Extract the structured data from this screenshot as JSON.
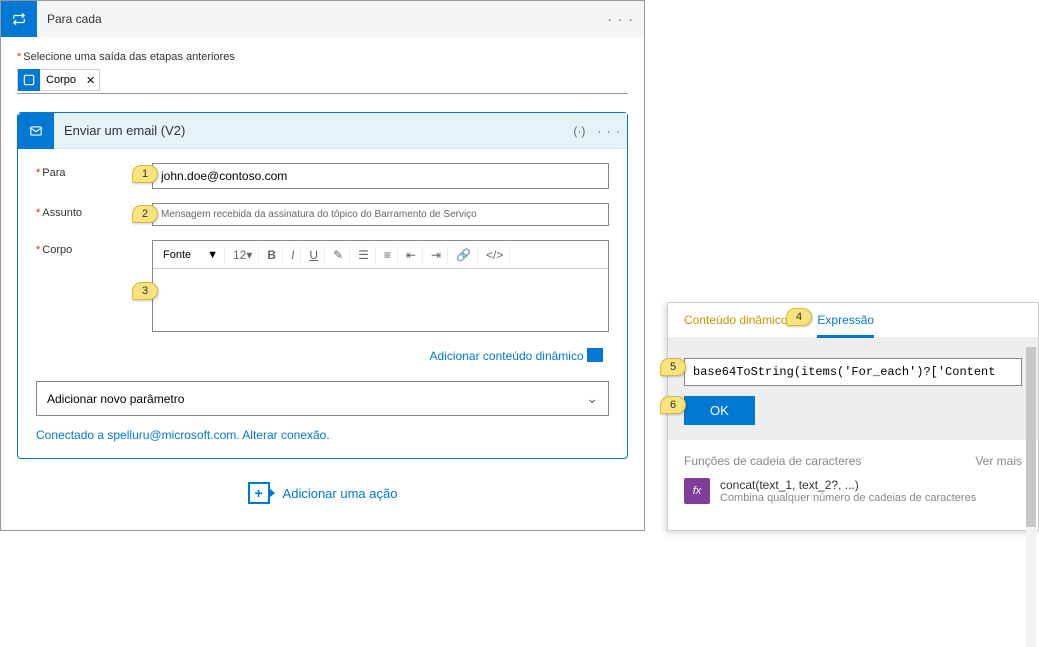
{
  "foreach": {
    "title": "Para cada",
    "output_label": "Selecione uma saída das etapas anteriores",
    "token_label": "Corpo",
    "token_close": "✕"
  },
  "email": {
    "header_title": "Enviar um email (V2)",
    "to_label": "Para",
    "to_value": "john.doe@contoso.com",
    "subject_label": "Assunto",
    "subject_value": "Mensagem recebida da assinatura do tópico do Barramento de Serviço",
    "body_label": "Corpo",
    "font_label": "Fonte",
    "font_size": "12",
    "add_dynamic_label": "Adicionar conteúdo dinâmico",
    "add_param_label": "Adicionar novo parâmetro",
    "connected_text": "Conectado a spelluru@microsoft.com. Alterar conexão."
  },
  "add_action": {
    "label": "Adicionar uma ação"
  },
  "dynamic_panel": {
    "tab_dynamic": "Conteúdo dinâmico",
    "tab_expression": "Expressão",
    "expression_value": "base64ToString(items('For_each')?['Content",
    "ok_label": "OK",
    "section_title": "Funções de cadeia de caracteres",
    "see_more": "Ver mais",
    "func_name": "concat(text_1, text_2?, ...)",
    "func_desc": "Combina qualquer número de cadeias de caracteres"
  },
  "badges": {
    "b1": "1",
    "b2": "2",
    "b3": "3",
    "b4": "4",
    "b5": "5",
    "b6": "6"
  }
}
